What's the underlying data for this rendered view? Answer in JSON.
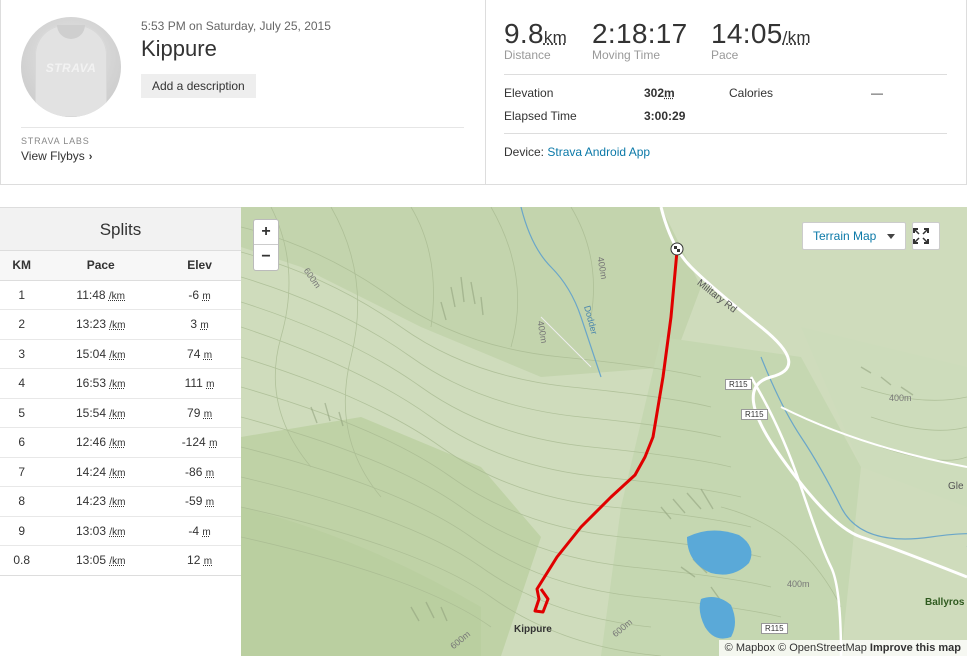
{
  "activity": {
    "datetime": "5:53 PM on Saturday, July 25, 2015",
    "title": "Kippure",
    "add_description": "Add a description",
    "avatar_logo": "STRAVA",
    "labs_label": "STRAVA LABS",
    "flybys_label": "View Flybys"
  },
  "stats": {
    "distance": {
      "value": "9.8",
      "unit": "km",
      "label": "Distance"
    },
    "moving_time": {
      "value": "2:18:17",
      "label": "Moving Time"
    },
    "pace": {
      "value": "14:05",
      "unit": "/km",
      "label": "Pace"
    },
    "elevation": {
      "label": "Elevation",
      "value": "302",
      "unit": "m"
    },
    "calories": {
      "label": "Calories",
      "value": "—"
    },
    "elapsed": {
      "label": "Elapsed Time",
      "value": "3:00:29"
    },
    "device": {
      "label": "Device:",
      "value": "Strava Android App"
    }
  },
  "splits": {
    "title": "Splits",
    "headers": [
      "KM",
      "Pace",
      "Elev"
    ],
    "rows": [
      {
        "km": "1",
        "pace": "11:48",
        "elev": "-6"
      },
      {
        "km": "2",
        "pace": "13:23",
        "elev": "3"
      },
      {
        "km": "3",
        "pace": "15:04",
        "elev": "74"
      },
      {
        "km": "4",
        "pace": "16:53",
        "elev": "111"
      },
      {
        "km": "5",
        "pace": "15:54",
        "elev": "79"
      },
      {
        "km": "6",
        "pace": "12:46",
        "elev": "-124"
      },
      {
        "km": "7",
        "pace": "14:24",
        "elev": "-86"
      },
      {
        "km": "8",
        "pace": "14:23",
        "elev": "-59"
      },
      {
        "km": "9",
        "pace": "13:03",
        "elev": "-4"
      },
      {
        "km": "0.8",
        "pace": "13:05",
        "elev": "12"
      }
    ],
    "pace_unit": "/km",
    "elev_unit": "m"
  },
  "map": {
    "zoom_in": "+",
    "zoom_out": "−",
    "terrain_label": "Terrain Map",
    "attribution_mapbox": "© Mapbox",
    "attribution_osm": "© OpenStreetMap",
    "attribution_improve": "Improve this map",
    "labels": {
      "kippure": "Kippure",
      "military_rd": "Military Rd",
      "dodder": "Dodder",
      "r115": "R115",
      "contour_400": "400m",
      "contour_600": "600m",
      "ballyros": "Ballyros",
      "gle": "Gle"
    },
    "colors": {
      "route": "#ee0000",
      "water": "#5aa9d8",
      "terrain": "#cfdcbc"
    }
  }
}
